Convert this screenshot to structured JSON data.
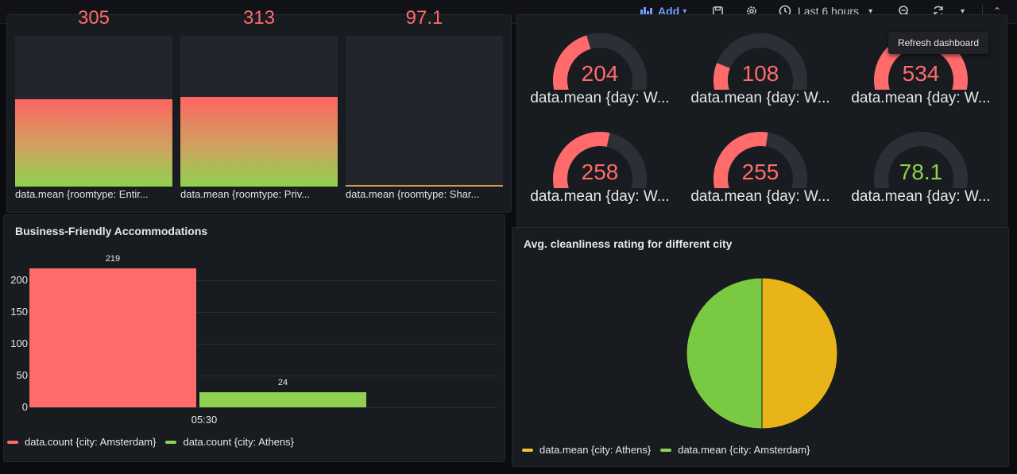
{
  "toolbar": {
    "add_label": "Add",
    "time_range": "Last 6 hours",
    "tooltip": "Refresh dashboard"
  },
  "bar_gauge": {
    "items": [
      {
        "value": "305",
        "label": "data.mean {roomtype: Entir...",
        "fill": 0.46
      },
      {
        "value": "313",
        "label": "data.mean {roomtype: Priv...",
        "fill": 0.47
      },
      {
        "value": "97.1",
        "label": "data.mean {roomtype: Shar...",
        "fill": 0.0
      }
    ]
  },
  "gauges": {
    "items": [
      {
        "value": "204",
        "label": "data.mean {day: W...",
        "fraction": 0.38,
        "color": "#ff6b6b"
      },
      {
        "value": "108",
        "label": "data.mean {day: W...",
        "fraction": 0.2,
        "color": "#ff6b6b"
      },
      {
        "value": "534",
        "label": "data.mean {day: W...",
        "fraction": 1.0,
        "color": "#ff6b6b"
      },
      {
        "value": "258",
        "label": "data.mean {day: W...",
        "fraction": 0.48,
        "color": "#ff6b6b"
      },
      {
        "value": "255",
        "label": "data.mean {day: W...",
        "fraction": 0.47,
        "color": "#ff6b6b"
      },
      {
        "value": "78.1",
        "label": "data.mean {day: W...",
        "fraction": 0.05,
        "color": "#8fd14f"
      }
    ]
  },
  "business_panel": {
    "title": "Business-Friendly Accommodations",
    "x_tick": "05:30"
  },
  "pie_panel": {
    "title": "Avg. cleanliness rating for different city"
  },
  "colors": {
    "red": "#ff6b6b",
    "green": "#8fd14f",
    "yellow": "#f2c12e",
    "pie_green": "#7ac943",
    "pie_yellow": "#e8b417"
  },
  "chart_data": [
    {
      "type": "bar",
      "title": "Business-Friendly Accommodations",
      "categories": [
        "05:30"
      ],
      "series": [
        {
          "name": "data.count {city: Amsterdam}",
          "values": [
            219
          ]
        },
        {
          "name": "data.count {city: Athens}",
          "values": [
            24
          ]
        }
      ],
      "yticks": [
        0,
        50,
        100,
        150,
        200
      ],
      "ylim": [
        0,
        230
      ],
      "grid": true,
      "legend": "bottom-left"
    },
    {
      "type": "pie",
      "title": "Avg. cleanliness rating for different city",
      "series": [
        {
          "name": "data.mean {city: Athens}",
          "values": [
            1
          ]
        },
        {
          "name": "data.mean {city: Amsterdam}",
          "values": [
            1
          ]
        }
      ],
      "legend": "bottom-left"
    }
  ]
}
